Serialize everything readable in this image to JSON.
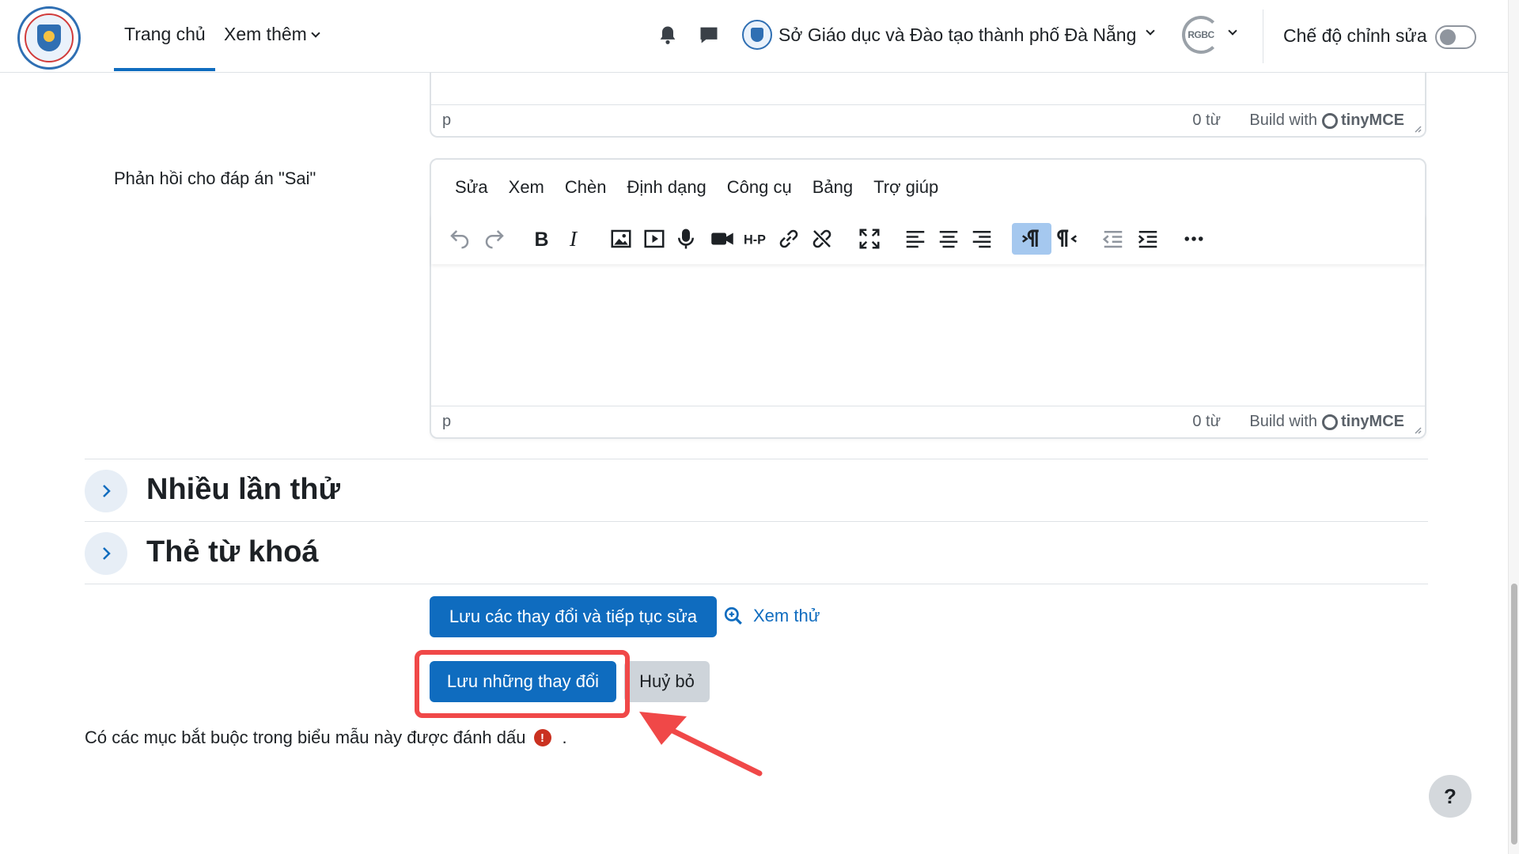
{
  "navbar": {
    "home": "Trang chủ",
    "more": "Xem thêm",
    "org_name": "Sở Giáo dục và Đào tạo thành phố Đà Nẵng",
    "user_initials": "RGBC",
    "edit_mode": "Chế độ chỉnh sửa",
    "edit_mode_on": false
  },
  "editor_top": {
    "path": "p",
    "word_count": "0 từ",
    "build_with": "Build with",
    "brand": "tinyMCE"
  },
  "feedback_false": {
    "label": "Phản hồi cho đáp án \"Sai\"",
    "menu": [
      "Sửa",
      "Xem",
      "Chèn",
      "Định dạng",
      "Công cụ",
      "Bảng",
      "Trợ giúp"
    ],
    "toolbar_icons": [
      "undo-icon",
      "redo-icon",
      "bold-icon",
      "italic-icon",
      "image-icon",
      "media-icon",
      "audio-record-icon",
      "video-record-icon",
      "h5p-icon",
      "link-icon",
      "unlink-icon",
      "fullscreen-icon",
      "align-left-icon",
      "align-center-icon",
      "align-right-icon",
      "ltr-icon",
      "rtl-icon",
      "outdent-icon",
      "indent-icon",
      "more-icon"
    ],
    "active_tool": "ltr-icon",
    "path": "p",
    "word_count": "0 từ",
    "build_with": "Build with",
    "brand": "tinyMCE"
  },
  "sections": [
    {
      "title": "Nhiều lần thử"
    },
    {
      "title": "Thẻ từ khoá"
    }
  ],
  "actions": {
    "save_continue": "Lưu các thay đổi và tiếp tục sửa",
    "preview": "Xem thử",
    "save": "Lưu những thay đổi",
    "cancel": "Huỷ bỏ"
  },
  "required_note": {
    "text": "Có các mục bắt buộc trong biểu mẫu này được đánh dấu",
    "suffix": "."
  },
  "help": "?",
  "colors": {
    "primary": "#0f6cbf",
    "highlight": "#f04848",
    "required": "#ca3120"
  }
}
